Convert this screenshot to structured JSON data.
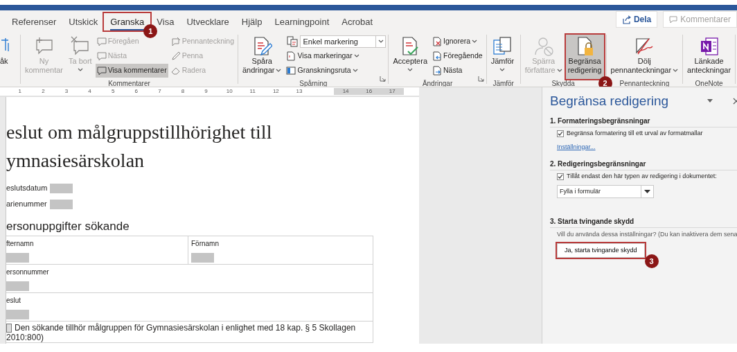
{
  "tabs": [
    {
      "label": "Referenser",
      "selected": false
    },
    {
      "label": "Utskick",
      "selected": false
    },
    {
      "label": "Granska",
      "selected": true,
      "callout": "1"
    },
    {
      "label": "Visa",
      "selected": false
    },
    {
      "label": "Utvecklare",
      "selected": false
    },
    {
      "label": "Hjälp",
      "selected": false
    },
    {
      "label": "Learningpoint",
      "selected": false
    },
    {
      "label": "Acrobat",
      "selected": false
    }
  ],
  "share_button": {
    "label": "Dela"
  },
  "comments_button": {
    "label": "Kommentarer",
    "disabled": true
  },
  "ribbon_edge": {
    "label": "åk"
  },
  "ribbon_groups": [
    {
      "label": "Kommentarer",
      "items": [
        {
          "kind": "large",
          "label": "Ny\nkommentar",
          "disabled": true,
          "on": false
        },
        {
          "kind": "large",
          "label": "Ta bort",
          "disabled": true,
          "on": false,
          "caret": true
        },
        {
          "kind": "column",
          "items": [
            {
              "kind": "small",
              "label": "Föregåen",
              "disabled": true,
              "on": false
            },
            {
              "kind": "small",
              "label": "Nästa",
              "disabled": true,
              "on": false
            },
            {
              "kind": "small",
              "label": "Visa kommentarer",
              "disabled": false,
              "on": true
            }
          ]
        },
        {
          "kind": "column",
          "items": [
            {
              "kind": "small",
              "label": "Pennanteckning",
              "disabled": true,
              "on": false
            },
            {
              "kind": "small",
              "label": "Penna",
              "disabled": true,
              "on": false
            },
            {
              "kind": "small",
              "label": "Radera",
              "disabled": true,
              "on": false
            }
          ]
        }
      ]
    },
    {
      "label": "Spårning",
      "launcher": true,
      "items": [
        {
          "kind": "large",
          "label": "Spåra\nändringar",
          "disabled": false,
          "on": false,
          "caret": true
        },
        {
          "kind": "column",
          "items": [
            {
              "kind": "select",
              "label": "Enkel markering",
              "disabled": false
            },
            {
              "kind": "small",
              "label": "Visa markeringar",
              "disabled": false,
              "on": false,
              "caret": true
            },
            {
              "kind": "small",
              "label": "Granskningsruta",
              "disabled": false,
              "on": false,
              "caret": true
            }
          ]
        }
      ]
    },
    {
      "label": "Ändringar",
      "launcher": true,
      "items": [
        {
          "kind": "large",
          "label": "Acceptera",
          "disabled": false,
          "on": false,
          "caret": true
        },
        {
          "kind": "column",
          "items": [
            {
              "kind": "small",
              "label": "Ignorera",
              "disabled": false,
              "on": false,
              "caret": true
            },
            {
              "kind": "small",
              "label": "Föregående",
              "disabled": false,
              "on": false
            },
            {
              "kind": "small",
              "label": "Nästa",
              "disabled": false,
              "on": false
            }
          ]
        }
      ]
    },
    {
      "label": "Jämför",
      "items": [
        {
          "kind": "large",
          "label": "Jämför",
          "disabled": false,
          "on": false,
          "caret": true
        }
      ]
    },
    {
      "label": "Skydda",
      "items": [
        {
          "kind": "large",
          "label": "Spärra\nförfattare",
          "disabled": true,
          "on": false,
          "caret": true
        },
        {
          "kind": "large",
          "label": "Begränsa\nredigering",
          "disabled": false,
          "on": true,
          "callout": "2"
        }
      ]
    },
    {
      "label": "Pennanteckning",
      "items": [
        {
          "kind": "large",
          "label": "Dölj\npennanteckningar",
          "disabled": false,
          "on": false,
          "caret": true
        }
      ]
    },
    {
      "label": "OneNote",
      "items": [
        {
          "kind": "large",
          "label": "Länkade\nanteckningar",
          "disabled": false,
          "on": false
        }
      ]
    }
  ],
  "ruler": [
    "1",
    "2",
    "3",
    "4",
    "5",
    "6",
    "7",
    "8",
    "9",
    "10",
    "11",
    "12",
    "13",
    "14",
    "16",
    "17"
  ],
  "document": {
    "title_lines": [
      "eslut om målgruppstillhörighet till",
      "ymnasiesärskolan"
    ],
    "fields": [
      {
        "label": "eslutsdatum"
      },
      {
        "label": "arienummer"
      }
    ],
    "section_heading": "ersonuppgifter sökande",
    "table": [
      {
        "kind": "fields",
        "cells": [
          {
            "label": "fternamn"
          },
          {
            "label": "Förnamn"
          }
        ]
      },
      {
        "kind": "fields",
        "cells": [
          {
            "label": "ersonnummer"
          }
        ]
      },
      {
        "kind": "fields",
        "cells": [
          {
            "label": "eslut"
          }
        ]
      },
      {
        "kind": "checkbox",
        "checked": false,
        "lines": [
          "Den sökande tillhör målgruppen för Gymnasiesärskolan i enlighet med 18 kap. § 5 Skollagen",
          "2010:800)"
        ]
      }
    ]
  },
  "pane": {
    "title": "Begränsa redigering",
    "sections": [
      {
        "heading": "1. Formateringsbegränsningar",
        "checkbox": {
          "label": "Begränsa formatering till ett urval av formatmallar",
          "checked": true
        },
        "link": "Inställningar..."
      },
      {
        "heading": "2. Redigeringsbegränsningar",
        "checkbox": {
          "label": "Tillåt endast den här typen av redigering i dokumentet:",
          "checked": true
        },
        "select": "Fylla i formulär"
      },
      {
        "heading": "3. Starta tvingande skydd",
        "text": "Vill du använda dessa inställningar? (Du kan inaktivera dem sena",
        "button": {
          "label": "Ja, starta tvingande skydd",
          "callout": "3"
        }
      }
    ]
  }
}
